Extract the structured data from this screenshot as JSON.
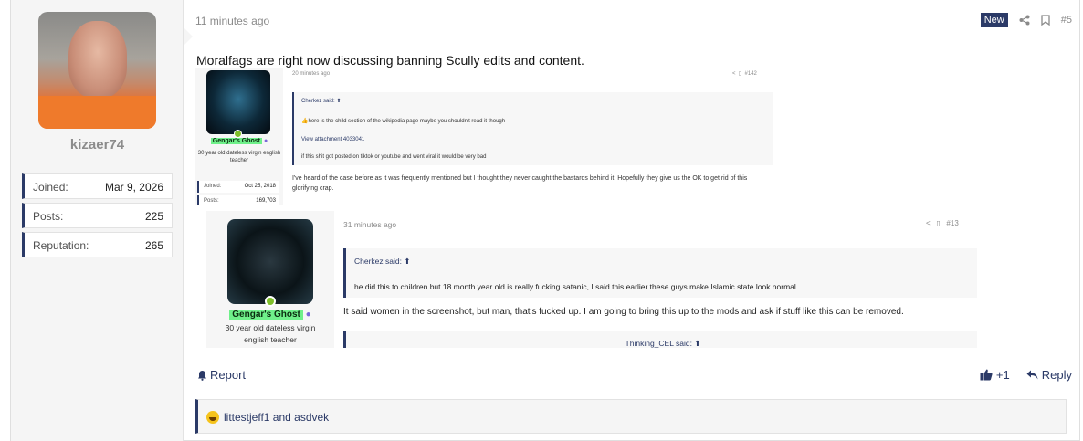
{
  "user": {
    "name": "kizaer74",
    "stats": [
      {
        "label": "Joined:",
        "value": "Mar 9, 2026"
      },
      {
        "label": "Posts:",
        "value": "225"
      },
      {
        "label": "Reputation:",
        "value": "265"
      }
    ]
  },
  "post": {
    "time": "11 minutes ago",
    "badge": "New",
    "number": "#5",
    "text": "Moralfags are right now discussing banning Scully edits and content."
  },
  "screenshot1": {
    "time": "20 minutes ago",
    "number": "#142",
    "user_name": "Gengar's Ghost",
    "user_sub": "30 year old dateless virgin english teacher",
    "stats": [
      {
        "label": "Joined:",
        "value": "Oct 25, 2018"
      },
      {
        "label": "Posts:",
        "value": "169,703"
      }
    ],
    "quote_author": "Cherkez said:",
    "quote_line1": "here is the child section of the wikipedia page maybe you shouldn't read it though",
    "quote_link": "View attachment 4033041",
    "quote_line2": "if this shit got posted on tiktok or youtube and went viral it would be very bad",
    "body": "I've heard of the case before as it was frequently mentioned but I thought they never caught the bastards behind it. Hopefully they give us the OK to get rid of this glorifying crap."
  },
  "screenshot2": {
    "time": "31 minutes ago",
    "number": "#13",
    "user_name": "Gengar's Ghost",
    "user_sub_line1": "30 year old dateless virgin",
    "user_sub_line2": "english teacher",
    "quote_author": "Cherkez said:",
    "quote_line": "he did this to children but 18 month year old is really fucking satanic, I said this earlier these guys make Islamic state look normal",
    "body": "It said women in the screenshot, but man, that's fucked up. I am going to bring this up to the mods and ask if stuff like this can be removed.",
    "quote2_author": "Thinking_CEL said:"
  },
  "footer": {
    "report": "Report",
    "like_count": "+1",
    "reply": "Reply"
  },
  "reactions": {
    "text": "littestjeff1 and asdvek"
  },
  "colors": {
    "accent": "#2b3a67",
    "highlight_name": "#6ff08a",
    "online": "#7fbf2a"
  }
}
